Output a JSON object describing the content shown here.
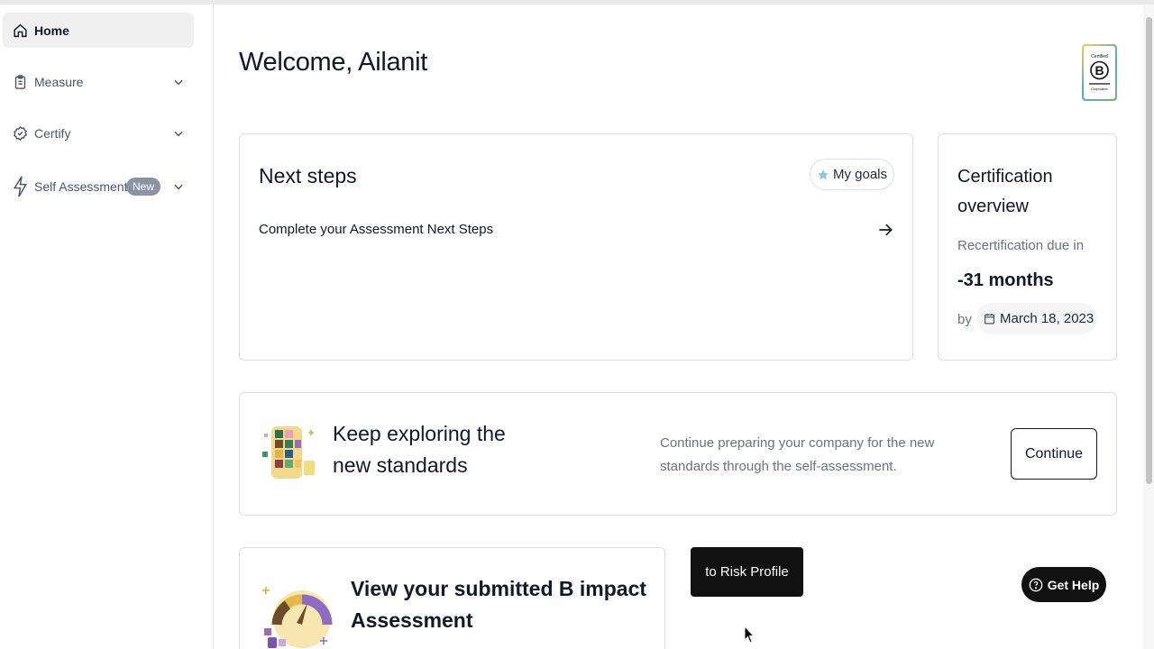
{
  "sidebar": {
    "items": [
      {
        "label": "Home",
        "icon": "home-icon"
      },
      {
        "label": "Measure",
        "icon": "clipboard-icon"
      },
      {
        "label": "Certify",
        "icon": "badge-check-icon"
      },
      {
        "label": "Self Assessment",
        "icon": "lightning-icon",
        "badge": "New"
      }
    ]
  },
  "header": {
    "welcome": "Welcome, Ailanit",
    "logo": {
      "top": "Certified",
      "letter": "B",
      "bottom": "Corporation"
    }
  },
  "next_steps": {
    "title": "Next steps",
    "goals_label": "My goals",
    "step": "Complete your Assessment Next Steps"
  },
  "certification": {
    "title": "Certification overview",
    "due_label": "Recertification due in",
    "months": "-31 months",
    "by_label": "by",
    "date": "March 18, 2023"
  },
  "explore": {
    "title": "Keep exploring the new standards",
    "description": "Continue preparing your company for the new standards through the self-assessment.",
    "button": "Continue"
  },
  "view": {
    "title": "View your submitted B impact Assessment"
  },
  "tooltip": {
    "label": "to Risk Profile"
  },
  "help": {
    "label": "Get Help"
  },
  "colors": {
    "accent_star": "#8ec5e6",
    "dark": "#111111",
    "badge": "#8a94a6"
  }
}
